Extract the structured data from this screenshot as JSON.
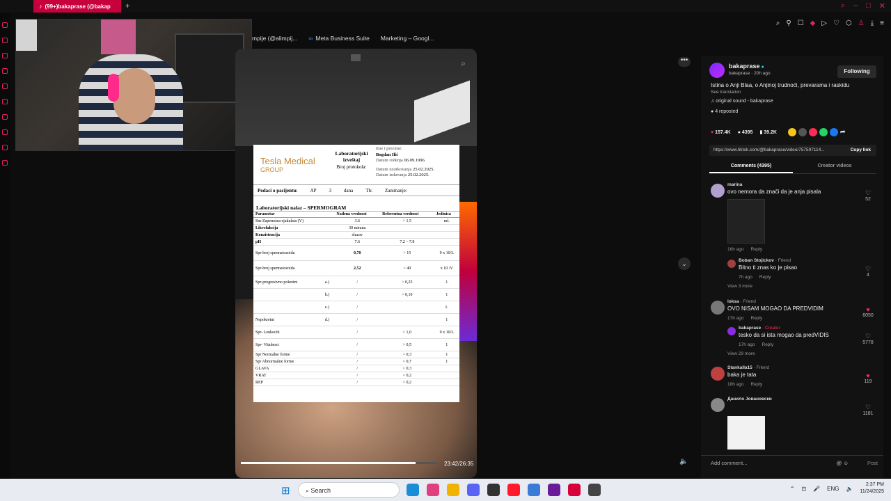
{
  "browser": {
    "tab_title": "(99+)bakaprase (@bakap",
    "new_tab_glyph": "+",
    "bookmarks": [
      "mpije (@alimpij...",
      "Meta Business Suite",
      "Marketing – Googl..."
    ]
  },
  "webcam": {
    "label": "streamer-webcam-overlay"
  },
  "video": {
    "timecode": "23:42/26:35",
    "progress_fraction": 0.89,
    "document": {
      "company_name": "Tesla Medical",
      "company_sub": "GROUP",
      "report_title": "Laboratorijski izveštaj",
      "protocol": "Broj protokola:",
      "name_label": "Ime i prezime:",
      "name_value": "Bogdan Ilić",
      "dob_label": "Datum rođenja",
      "dob_value": "06.09.1996.",
      "sample_label": "Datum uzorkovanja",
      "sample_value": "25.02.2025.",
      "issued_label": "Datum izdavanja",
      "issued_value": "25.02.2025.",
      "patient_row": "Podaci o pacijentu:",
      "patient_ap": "AP",
      "patient_num": "3",
      "patient_dana": "dana",
      "patient_th": "Th:",
      "patient_zan": "Zanimanje:",
      "section": "Laboratorijski nalaz – SPERMOGRAM",
      "columns": [
        "Parametar",
        "",
        "Nađena vrednost",
        "Referentna vrednost",
        "Jedinica"
      ],
      "rows": [
        [
          "Sm-Zapremina ejakulata (V)",
          "",
          "3.6",
          "> 1.5",
          "ml."
        ],
        [
          "Likvefakcija",
          "",
          "30 minuta",
          "",
          ""
        ],
        [
          "Konzistencija",
          "",
          "sluzav",
          "",
          ""
        ],
        [
          "pH",
          "",
          "7.6",
          "7.2 – 7.8",
          ""
        ],
        [
          "Spr-broj spermatozoida",
          "",
          "0,70",
          "> 15",
          "9 x 10/L"
        ],
        [
          "Spr-broj spermatozoida",
          "",
          "2,52",
          "> 40",
          "x 10 /V"
        ],
        [
          "Spr-progresivno pokretni",
          "a.)",
          "/",
          "> 0,25",
          "1"
        ],
        [
          "",
          "b.)",
          "/",
          "> 0,10",
          "1"
        ],
        [
          "",
          "c.)",
          "/",
          "",
          "L"
        ],
        [
          "Nepokretni",
          "d.)",
          "/",
          "",
          "1"
        ],
        [
          "Spr- Leukociti",
          "",
          "/",
          "< 1,0",
          "9 x 10/L"
        ],
        [
          "Spr- Vitalnost",
          "",
          "/",
          "> 0,5",
          "1"
        ],
        [
          "Spr   Normalne forme",
          "",
          "/",
          "> 0,3",
          "1"
        ],
        [
          "Spr   Abnormalne forme",
          "",
          "/",
          "< 0,7",
          "1"
        ],
        [
          "GLAVA",
          "",
          "/",
          "< 0,3",
          ""
        ],
        [
          "VRAT",
          "",
          "/",
          "< 0,2",
          ""
        ],
        [
          "REP",
          "",
          "/",
          "< 0,2",
          ""
        ]
      ]
    }
  },
  "panel": {
    "author": "bakaprase",
    "author_meta": "bakaprase · 20h ago",
    "follow_label": "Following",
    "caption": "Istina o Anji Blaa, o Anjinoj trudnoći, prevarama i raskidu",
    "see_translation": "See translation",
    "sound": "original sound - bakaprase",
    "reposted": "4 reposted",
    "likes": "157.4K",
    "comments_count": "4395",
    "saves": "39.2K",
    "url": "https://www.tiktok.com/@bakaprase/video/757597114...",
    "copy_link": "Copy link",
    "tab_comments": "Comments (4395)",
    "tab_creator": "Creator videos",
    "add_comment": "Add comment...",
    "post": "Post",
    "comments": [
      {
        "name": "marina",
        "tag": "",
        "text": "ovo nemora da znači da je anja pisala",
        "meta": "16h ago",
        "reply": "Reply",
        "likes": "52"
      },
      {
        "name": "Boban Stojickov",
        "tag": " · Friend",
        "text": "Bitno ti znas ko je pisao",
        "meta": "7h ago",
        "reply": "Reply",
        "likes": "4"
      },
      {
        "name": "loksa",
        "tag": " · Friend",
        "text": "OVO NISAM MOGAO DA PREDVIDIM",
        "meta": "17h ago",
        "reply": "Reply",
        "likes": "6050"
      },
      {
        "name": "bakaprase",
        "tag": " · Creator",
        "text": "tesko da si ista mogao da predVIDIS",
        "meta": "17h ago",
        "reply": "Reply",
        "likes": "5778"
      },
      {
        "name": "Stankalla15",
        "tag": " · Friend",
        "text": "baka je tata",
        "meta": "18h ago",
        "reply": "Reply",
        "likes": "119"
      },
      {
        "name": "Данило Јовановски",
        "tag": "",
        "text": "",
        "meta": "",
        "reply": "",
        "likes": "1181"
      }
    ],
    "view_more_1": "View 3 more",
    "view_more_2": "View 29 more"
  },
  "taskbar": {
    "search": "Search",
    "lang": "ENG",
    "time": "2:37 PM",
    "date": "11/24/2025"
  }
}
